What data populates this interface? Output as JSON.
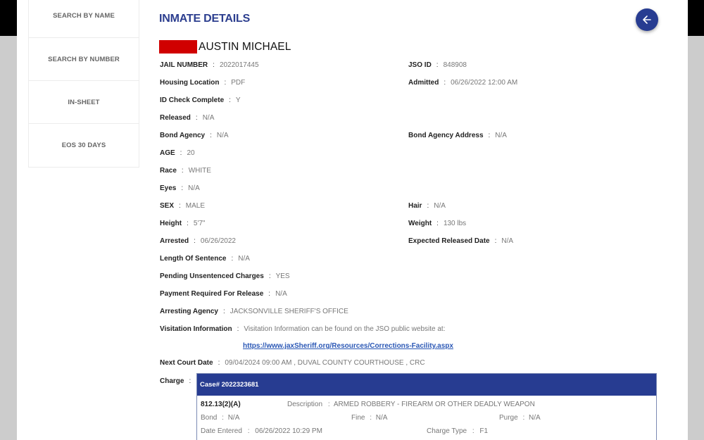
{
  "sidebar": {
    "items": [
      {
        "label": "SEARCH BY NAME"
      },
      {
        "label": "SEARCH BY NUMBER"
      },
      {
        "label": "IN-SHEET"
      },
      {
        "label": "EOS 30 DAYS"
      }
    ]
  },
  "header": {
    "title": "INMATE DETAILS",
    "back_icon": "arrow-left-icon"
  },
  "inmate": {
    "name": "AUSTIN MICHAEL",
    "redaction_color": "#d00000"
  },
  "fields": {
    "jail_number": {
      "label": "JAIL NUMBER",
      "value": "2022017445"
    },
    "jso_id": {
      "label": "JSO ID",
      "value": "848908"
    },
    "housing_location": {
      "label": "Housing Location",
      "value": "PDF"
    },
    "admitted": {
      "label": "Admitted",
      "value": "06/26/2022 12:00 AM"
    },
    "id_check_complete": {
      "label": "ID Check Complete",
      "value": "Y"
    },
    "released": {
      "label": "Released",
      "value": "N/A"
    },
    "bond_agency": {
      "label": "Bond Agency",
      "value": "N/A"
    },
    "bond_agency_address": {
      "label": "Bond Agency Address",
      "value": "N/A"
    },
    "age": {
      "label": "AGE",
      "value": "20"
    },
    "race": {
      "label": "Race",
      "value": "WHITE"
    },
    "eyes": {
      "label": "Eyes",
      "value": "N/A"
    },
    "sex": {
      "label": "SEX",
      "value": "MALE"
    },
    "hair": {
      "label": "Hair",
      "value": "N/A"
    },
    "height": {
      "label": "Height",
      "value": "5'7\""
    },
    "weight": {
      "label": "Weight",
      "value": "130 lbs"
    },
    "arrested": {
      "label": "Arrested",
      "value": "06/26/2022"
    },
    "expected_released_date": {
      "label": "Expected Released Date",
      "value": "N/A"
    },
    "length_of_sentence": {
      "label": "Length Of Sentence",
      "value": "N/A"
    },
    "pending_unsentenced_charges": {
      "label": "Pending Unsentenced Charges",
      "value": "YES"
    },
    "payment_required_for_release": {
      "label": "Payment Required For Release",
      "value": "N/A"
    },
    "arresting_agency": {
      "label": "Arresting Agency",
      "value": "JACKSONVILLE SHERIFF'S OFFICE"
    },
    "visitation_information": {
      "label": "Visitation Information",
      "value": "Visitation Information can be found on the JSO public website at:",
      "link": "https://www.jaxSheriff.org/Resources/Corrections-Facility.aspx"
    },
    "next_court_date": {
      "label": "Next Court Date",
      "value": "09/04/2024 09:00 AM , DUVAL COUNTY COURTHOUSE , CRC"
    },
    "charge_label": "Charge"
  },
  "separator": ":",
  "charges": [
    {
      "case": "Case# 2022323681",
      "statute": "812.13(2)(A)",
      "description_label": "Description",
      "description": "ARMED ROBBERY - FIREARM OR OTHER DEADLY WEAPON",
      "bond_label": "Bond",
      "bond": "N/A",
      "fine_label": "Fine",
      "fine": "N/A",
      "purge_label": "Purge",
      "purge": "N/A",
      "date_entered_label": "Date Entered",
      "date_entered": "06/26/2022 10:29 PM",
      "charge_type_label": "Charge Type",
      "charge_type": "F1"
    }
  ],
  "colors": {
    "accent": "#273c91",
    "title": "#2c3e8f",
    "link": "#2a57b5"
  }
}
